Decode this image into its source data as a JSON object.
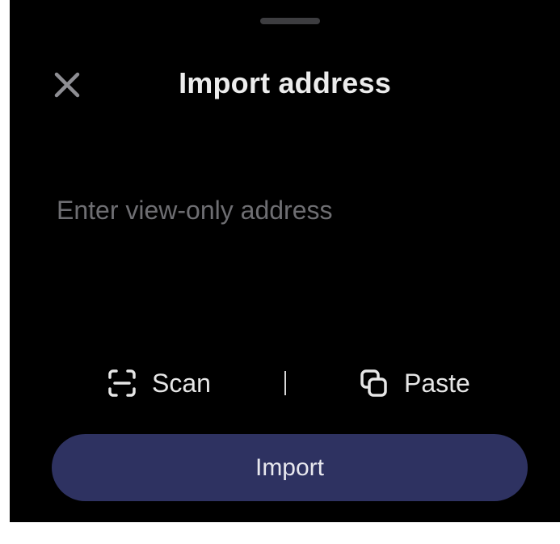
{
  "sheet": {
    "title": "Import address",
    "close_icon": "close-icon"
  },
  "address": {
    "placeholder": "Enter view-only address",
    "value": ""
  },
  "actions": {
    "scan_label": "Scan",
    "scan_icon": "scan-icon",
    "separator": "|",
    "paste_label": "Paste",
    "paste_icon": "copy-icon"
  },
  "import_button": {
    "label": "Import"
  },
  "colors": {
    "background": "#000000",
    "primary_button": "#2e3261",
    "placeholder": "#6e6e72"
  }
}
